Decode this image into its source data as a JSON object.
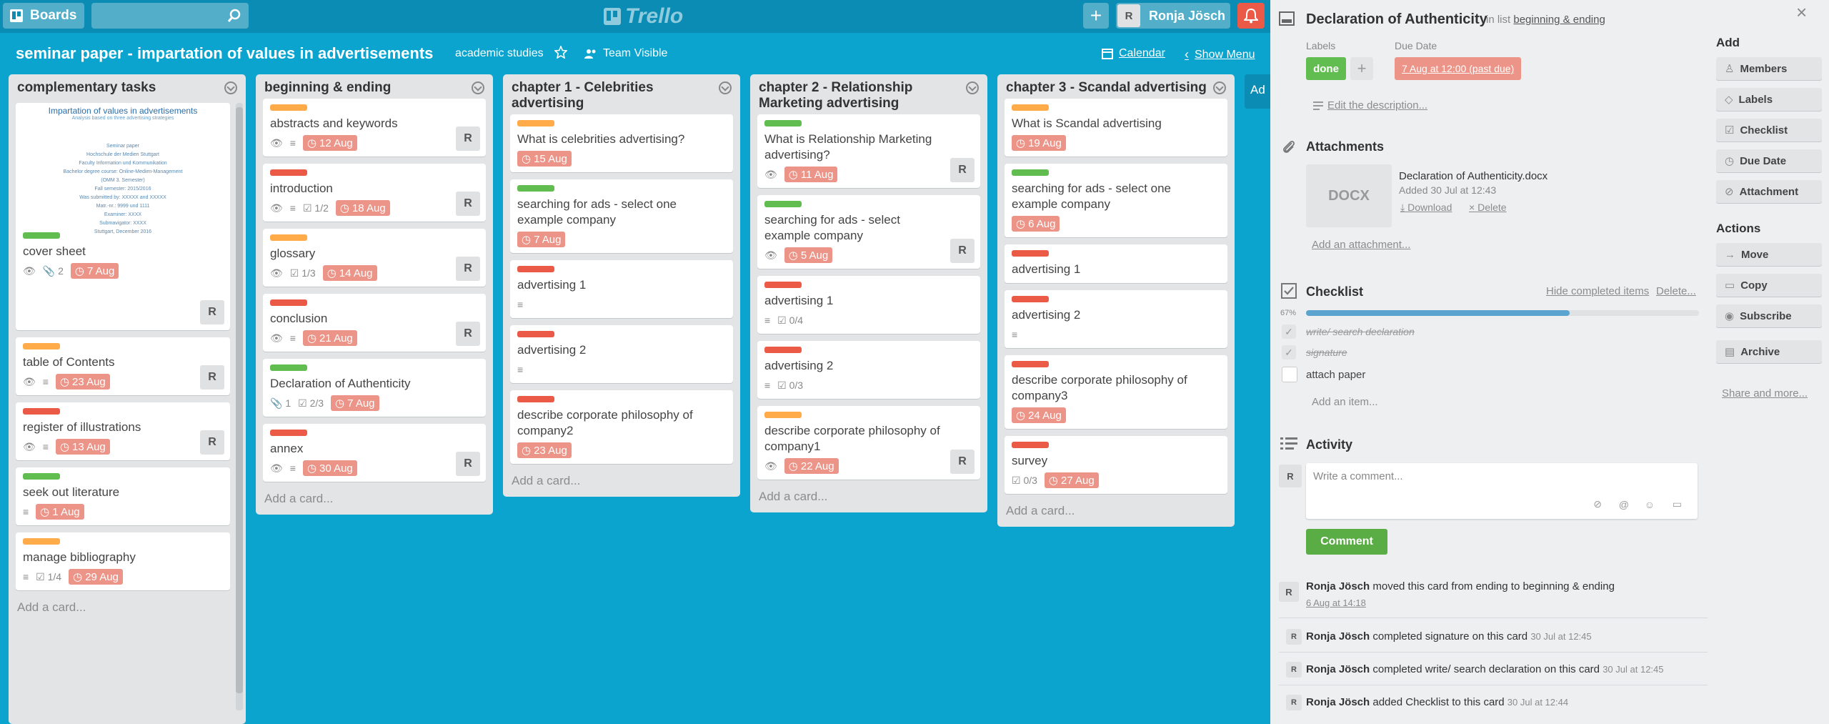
{
  "topbar": {
    "boards_label": "Boards",
    "logo": "Trello",
    "user_initial": "R",
    "user_name": "Ronja Jösch"
  },
  "board": {
    "title": "seminar paper - impartation of values in advertisements",
    "team": "academic studies",
    "visibility": "Team Visible",
    "calendar": "Calendar",
    "show_menu": "Show Menu",
    "add_list_stub": "Ad"
  },
  "lists": [
    {
      "title": "complementary tasks",
      "add": "Add a card...",
      "cover": {
        "t1": "Impartation of values in advertisements",
        "t2": "Analysis based on three advertising strategies",
        "lines": [
          "Seminar paper",
          "Hochschule der Medien Stuttgart",
          "Faculty Information und Kommunikation",
          "Bachelor degree course: Online-Medien-Management",
          "(OMM 3. Semester)",
          "",
          "Fall semester: 2015/2016",
          "Was submitted by: XXXXX and XXXXX",
          "Matr.-nr.: 9999 und 1111",
          "",
          "Examiner: XXXX",
          "Submavigator: XXXX",
          "",
          "Stuttgart, December 2016"
        ]
      },
      "cards": [
        {
          "label": "green",
          "title": "cover sheet",
          "watch": true,
          "attach": "2",
          "due": "7 Aug",
          "avatar": "R"
        },
        {
          "label": "orange",
          "title": "table of Contents",
          "watch": true,
          "desc": true,
          "due": "23 Aug",
          "avatar": "R"
        },
        {
          "label": "red",
          "title": "register of illustrations",
          "watch": true,
          "desc": true,
          "due": "13 Aug",
          "avatar": "R"
        },
        {
          "label": "green",
          "title": "seek out literature",
          "desc": true,
          "due": "1 Aug"
        },
        {
          "label": "orange",
          "title": "manage bibliography",
          "desc": true,
          "check": "1/4",
          "due": "29 Aug"
        }
      ]
    },
    {
      "title": "beginning & ending",
      "add": "Add a card...",
      "cards": [
        {
          "label": "orange",
          "title": "abstracts and keywords",
          "watch": true,
          "desc": true,
          "due": "12 Aug",
          "avatar": "R"
        },
        {
          "label": "red",
          "title": "introduction",
          "watch": true,
          "desc": true,
          "check": "1/2",
          "due": "18 Aug",
          "avatar": "R"
        },
        {
          "label": "orange",
          "title": "glossary",
          "watch": true,
          "check": "1/3",
          "due": "14 Aug",
          "avatar": "R"
        },
        {
          "label": "red",
          "title": "conclusion",
          "watch": true,
          "desc": true,
          "due": "21 Aug",
          "avatar": "R"
        },
        {
          "label": "green",
          "title": "Declaration of Authenticity",
          "attach": "1",
          "check": "2/3",
          "due": "7 Aug"
        },
        {
          "label": "red",
          "title": "annex",
          "watch": true,
          "desc": true,
          "due": "30 Aug",
          "avatar": "R"
        }
      ]
    },
    {
      "title": "chapter 1 - Celebrities advertising",
      "add": "Add a card...",
      "cards": [
        {
          "label": "orange",
          "title": "What is celebrities advertising?",
          "due": "15 Aug"
        },
        {
          "label": "green",
          "title": "searching for ads - select one example company",
          "due": "7 Aug"
        },
        {
          "label": "red",
          "title": "advertising 1",
          "desc": true
        },
        {
          "label": "red",
          "title": "advertising 2",
          "desc": true
        },
        {
          "label": "red",
          "title": "describe corporate philosophy of company2",
          "due": "23 Aug"
        }
      ]
    },
    {
      "title": "chapter 2 - Relationship Marketing advertising",
      "add": "Add a card...",
      "cards": [
        {
          "label": "green",
          "title": "What is Relationship Marketing advertising?",
          "watch": true,
          "due": "11 Aug",
          "avatar": "R"
        },
        {
          "label": "green",
          "title": "searching for ads - select example company",
          "watch": true,
          "due": "5 Aug",
          "avatar": "R"
        },
        {
          "label": "red",
          "title": "advertising 1",
          "desc": true,
          "check": "0/4"
        },
        {
          "label": "red",
          "title": "advertising 2",
          "desc": true,
          "check": "0/3"
        },
        {
          "label": "orange",
          "title": "describe corporate philosophy of company1",
          "watch": true,
          "due": "22 Aug",
          "avatar": "R"
        }
      ]
    },
    {
      "title": "chapter 3 - Scandal advertising",
      "add": "Add a card...",
      "cards": [
        {
          "label": "orange",
          "title": "What is Scandal advertising",
          "due": "19 Aug"
        },
        {
          "label": "green",
          "title": "searching for ads - select one example company",
          "due": "6 Aug"
        },
        {
          "label": "red",
          "title": "advertising 1"
        },
        {
          "label": "red",
          "title": "advertising 2",
          "desc": true
        },
        {
          "label": "red",
          "title": "describe corporate philosophy of company3",
          "due": "24 Aug"
        },
        {
          "label": "red",
          "title": "survey",
          "check": "0/3",
          "due": "27 Aug"
        }
      ]
    }
  ],
  "panel": {
    "title": "Declaration of Authenticity",
    "in_list_prefix": "in list",
    "in_list": "beginning & ending",
    "labels_title": "Labels",
    "label_done": "done",
    "due_title": "Due Date",
    "due_value": "7 Aug at 12:00 (past due)",
    "edit_desc": "Edit the description...",
    "attachments_title": "Attachments",
    "att_thumb": "DOCX",
    "att_name": "Declaration of Authenticity.docx",
    "att_added": "Added 30 Jul at 12:43",
    "att_download": "Download",
    "att_delete": "Delete",
    "add_attachment": "Add an attachment...",
    "checklist_title": "Checklist",
    "hide_completed": "Hide completed items",
    "delete": "Delete...",
    "progress_label": "67%",
    "progress": 0.67,
    "items": [
      {
        "text": "write/ search declaration",
        "done": true
      },
      {
        "text": "signature",
        "done": true
      },
      {
        "text": "attach paper",
        "done": false
      }
    ],
    "add_item": "Add an item...",
    "activity_title": "Activity",
    "comment_placeholder": "Write a comment...",
    "comment_button": "Comment",
    "activities": [
      {
        "user": "Ronja Jösch",
        "text": "moved this card from ending to beginning & ending",
        "ts": "6 Aug at 14:18"
      },
      {
        "user": "Ronja Jösch",
        "text": "completed signature on this card",
        "ts": "30 Jul at 12:45"
      },
      {
        "user": "Ronja Jösch",
        "text": "completed write/ search declaration on this card",
        "ts": "30 Jul at 12:45"
      },
      {
        "user": "Ronja Jösch",
        "text": "added Checklist to this card",
        "ts": "30 Jul at 12:44"
      }
    ],
    "add_title": "Add",
    "add_buttons": [
      "Members",
      "Labels",
      "Checklist",
      "Due Date",
      "Attachment"
    ],
    "actions_title": "Actions",
    "action_buttons": [
      "Move",
      "Copy",
      "Subscribe",
      "Archive"
    ],
    "share": "Share and more..."
  },
  "colors": {
    "board_bg": "#0aa4cf",
    "topbar": "#0a8cb4",
    "green": "#61bd4f",
    "orange": "#ffab4a",
    "red": "#eb5a46",
    "due_bg": "#ec9488"
  }
}
